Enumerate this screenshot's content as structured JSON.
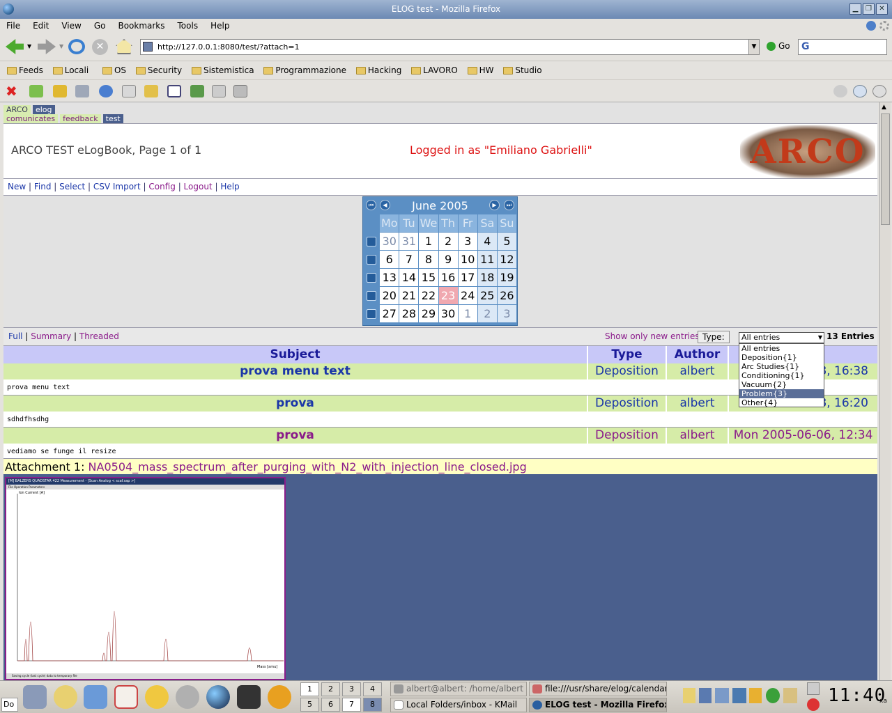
{
  "window": {
    "title": "ELOG test - Mozilla Firefox"
  },
  "menubar": [
    "File",
    "Edit",
    "View",
    "Go",
    "Bookmarks",
    "Tools",
    "Help"
  ],
  "navbar": {
    "url": "http://127.0.0.1:8080/test/?attach=1",
    "go_label": "Go"
  },
  "bookmarks": [
    "Feeds",
    "Locali",
    "OS",
    "Security",
    "Sistemistica",
    "Programmazione",
    "Hacking",
    "LAVORO",
    "HW",
    "Studio"
  ],
  "elog": {
    "tabs1": [
      "ARCO",
      "elog"
    ],
    "tabs2": [
      "comunicates",
      "feedback",
      "test"
    ],
    "title": "ARCO TEST eLogBook, Page 1 of 1",
    "login": "Logged in as \"Emiliano Gabrielli\"",
    "logo": "ARCO",
    "commands": [
      "New",
      "Find",
      "Select",
      "CSV Import",
      "Config",
      "Logout",
      "Help"
    ],
    "calendar": {
      "month": "June 2005",
      "days": [
        "Mo",
        "Tu",
        "We",
        "Th",
        "Fr",
        "Sa",
        "Su"
      ],
      "weeks": [
        [
          "30",
          "31",
          "1",
          "2",
          "3",
          "4",
          "5"
        ],
        [
          "6",
          "7",
          "8",
          "9",
          "10",
          "11",
          "12"
        ],
        [
          "13",
          "14",
          "15",
          "16",
          "17",
          "18",
          "19"
        ],
        [
          "20",
          "21",
          "22",
          "23",
          "24",
          "25",
          "26"
        ],
        [
          "27",
          "28",
          "29",
          "30",
          "1",
          "2",
          "3"
        ]
      ],
      "today": "23"
    },
    "views": [
      "Full",
      "Summary",
      "Threaded"
    ],
    "show_new": "Show only new entries",
    "type_label": "Type:",
    "filter_selected": "All entries",
    "filter_options": [
      "All entries",
      "Deposition{1}",
      "Arc Studies{1}",
      "Conditioning{1}",
      "Vacuum{2}",
      "Problem{3}",
      "Other{4}"
    ],
    "filter_highlight": "Problem{3}",
    "entry_count": "13 Entries",
    "columns": {
      "subject": "Subject",
      "type": "Type",
      "author": "Author"
    },
    "entries": [
      {
        "subject": "prova menu text",
        "type": "Deposition",
        "author": "albert",
        "date": "8, 16:38",
        "body": "prova menu text"
      },
      {
        "subject": "prova",
        "type": "Deposition",
        "author": "albert",
        "date": "8, 16:20",
        "body": "sdhdfhsdhg"
      },
      {
        "subject": "prova",
        "type": "Deposition",
        "author": "albert",
        "date": "Mon 2005-06-06, 12:34",
        "body": "vediamo se funge il resize"
      }
    ],
    "attachment": {
      "label": "Attachment 1:",
      "filename": "NA0504_mass_spectrum_after_purging_with_N2_with_injection_line_closed.jpg"
    },
    "screenshot": {
      "title": "[M] BALZERS QUADSTAR 422 Measurement - [Scan Analog  < scaf.sap >]",
      "menu": "File   Operation   Parameters",
      "ylabel": "Ion Current [A]",
      "xlabel": "Mass [amu]",
      "status": "Saving cycle (last cycle) data to temporary file"
    }
  },
  "taskbar": {
    "pager": [
      "1",
      "2",
      "3",
      "4",
      "5",
      "6",
      "7",
      "8"
    ],
    "tasks": [
      "albert@albert: /home/albert",
      "file:///usr/share/elog/calendar",
      "Local Folders/inbox - KMail",
      "ELOG test - Mozilla Firefox"
    ],
    "clock": "11:40",
    "left_text": "Do"
  }
}
